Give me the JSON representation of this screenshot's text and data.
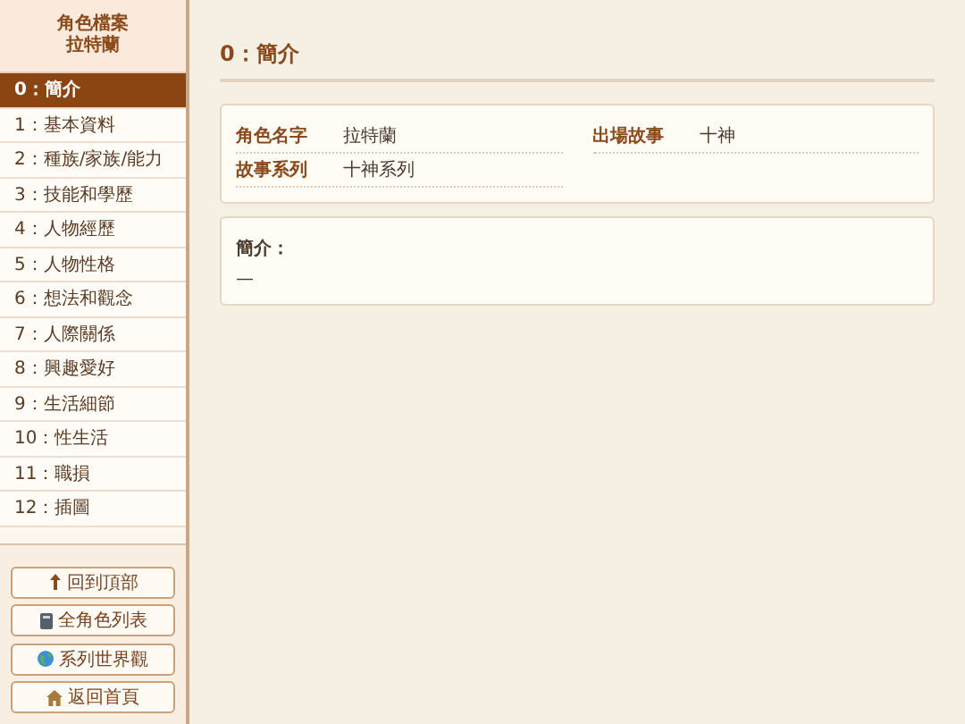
{
  "sidebar": {
    "title_lines": [
      "角色檔案",
      "拉特蘭"
    ],
    "items": [
      {
        "label": "0：簡介",
        "selected": true
      },
      {
        "label": "1：基本資料",
        "selected": false
      },
      {
        "label": "2：種族/家族/能力",
        "selected": false
      },
      {
        "label": "3：技能和學歷",
        "selected": false
      },
      {
        "label": "4：人物經歷",
        "selected": false
      },
      {
        "label": "5：人物性格",
        "selected": false
      },
      {
        "label": "6：想法和觀念",
        "selected": false
      },
      {
        "label": "7：人際關係",
        "selected": false
      },
      {
        "label": "8：興趣愛好",
        "selected": false
      },
      {
        "label": "9：生活細節",
        "selected": false
      },
      {
        "label": "10：性生活",
        "selected": false
      },
      {
        "label": "11：職損",
        "selected": false
      },
      {
        "label": "12：插圖",
        "selected": false
      }
    ],
    "buttons": [
      {
        "kind": "up",
        "label": "回到頂部"
      },
      {
        "kind": "book",
        "label": "全角色列表"
      },
      {
        "kind": "globe",
        "label": "系列世界觀"
      },
      {
        "kind": "home",
        "label": "返回首頁"
      }
    ]
  },
  "main": {
    "title": "0：簡介",
    "fields": [
      {
        "label": "角色名字",
        "value": "拉特蘭"
      },
      {
        "label": "出場故事",
        "value": "十神"
      },
      {
        "label": "故事系列",
        "value": "十神系列"
      }
    ],
    "intro": {
      "label": "簡介：",
      "text": "—"
    }
  }
}
